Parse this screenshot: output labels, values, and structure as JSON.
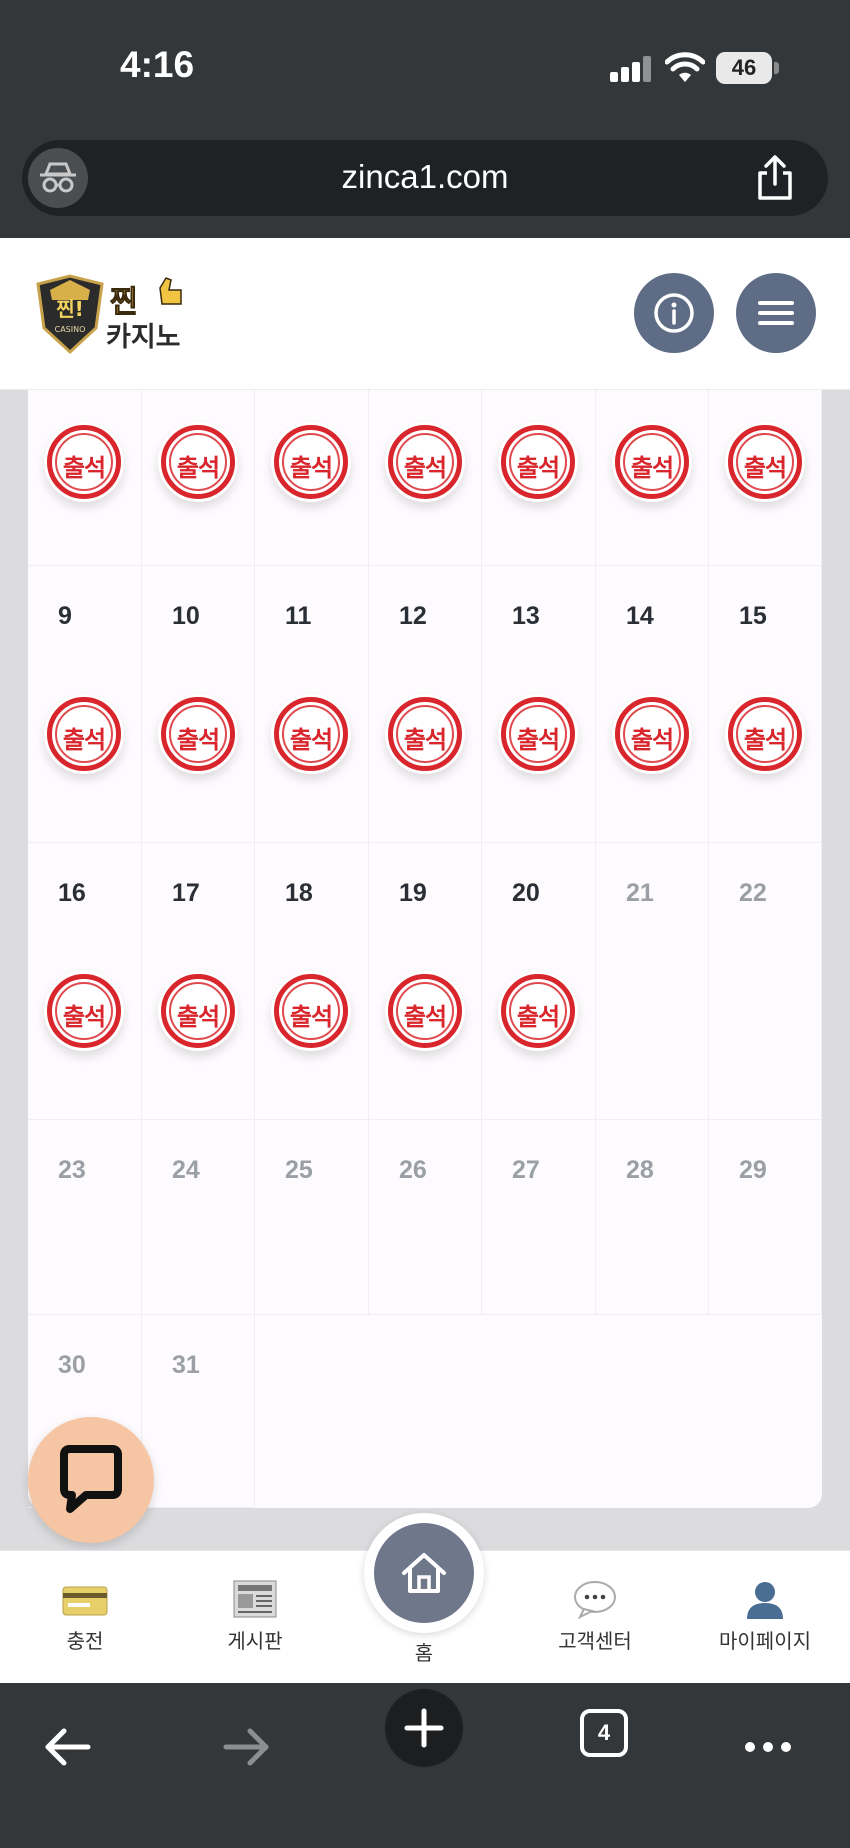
{
  "status_bar": {
    "time": "4:16",
    "battery": "46"
  },
  "browser": {
    "url": "zinca1.com",
    "tab_count": "4"
  },
  "site": {
    "logo_text": "찐카지노",
    "logo_badge": "찐!",
    "logo_sub": "CASINO"
  },
  "calendar": {
    "stamp_label": "출석",
    "weeks": [
      {
        "days": [
          "",
          "",
          "",
          "",
          "",
          "",
          ""
        ],
        "stamped": [
          true,
          true,
          true,
          true,
          true,
          true,
          true
        ],
        "future": [
          false,
          false,
          false,
          false,
          false,
          false,
          false
        ]
      },
      {
        "days": [
          "9",
          "10",
          "11",
          "12",
          "13",
          "14",
          "15"
        ],
        "stamped": [
          true,
          true,
          true,
          true,
          true,
          true,
          true
        ],
        "future": [
          false,
          false,
          false,
          false,
          false,
          false,
          false
        ]
      },
      {
        "days": [
          "16",
          "17",
          "18",
          "19",
          "20",
          "21",
          "22"
        ],
        "stamped": [
          true,
          true,
          true,
          true,
          true,
          false,
          false
        ],
        "future": [
          false,
          false,
          false,
          false,
          false,
          true,
          true
        ]
      },
      {
        "days": [
          "23",
          "24",
          "25",
          "26",
          "27",
          "28",
          "29"
        ],
        "stamped": [
          false,
          false,
          false,
          false,
          false,
          false,
          false
        ],
        "future": [
          true,
          true,
          true,
          true,
          true,
          true,
          true
        ]
      },
      {
        "days": [
          "30",
          "31"
        ],
        "stamped": [
          false,
          false
        ],
        "future": [
          true,
          true
        ]
      }
    ]
  },
  "bottom_nav": {
    "items": [
      {
        "label": "충전",
        "icon": "credit-card-icon"
      },
      {
        "label": "게시판",
        "icon": "newspaper-icon"
      },
      {
        "label": "홈",
        "icon": "home-icon"
      },
      {
        "label": "고객센터",
        "icon": "speech-bubble-icon"
      },
      {
        "label": "마이페이지",
        "icon": "user-icon"
      }
    ]
  }
}
